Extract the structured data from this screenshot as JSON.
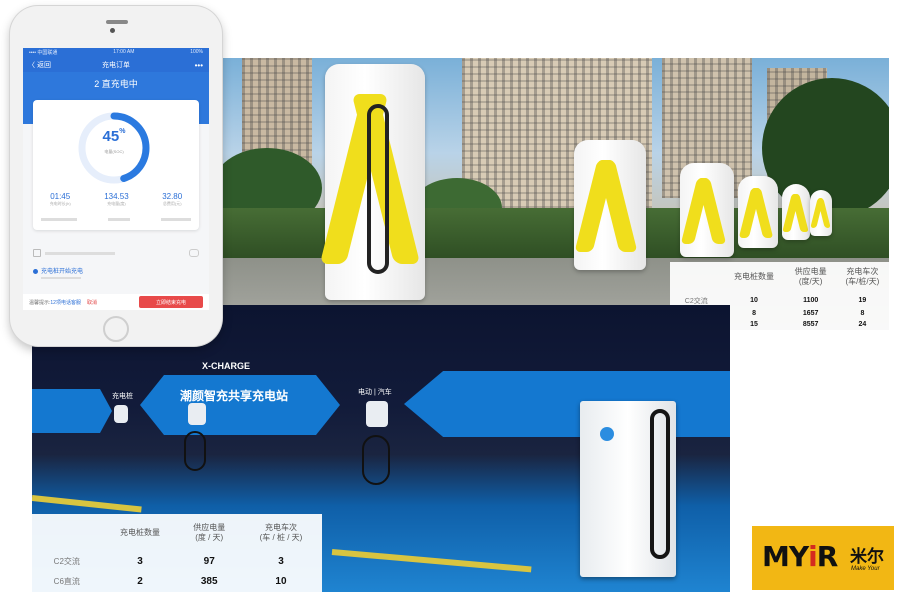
{
  "phone": {
    "status_left": "•••• 中国联通",
    "status_time": "17:00 AM",
    "status_right": "100%",
    "nav_back": "〈 返回",
    "nav_title": "充电订单",
    "nav_more": "•••",
    "heading": "2 直充电中",
    "percent": "45",
    "percent_unit": "%",
    "percent_sub": "电量(SOC)",
    "progress": 0.45,
    "stats": [
      {
        "value": "01:45",
        "label": "充电时长(h)"
      },
      {
        "value": "134.53",
        "label": "充电量(度)"
      },
      {
        "value": "32.80",
        "label": "总费用(元)"
      }
    ],
    "option_label": "充电桩开始充电",
    "bottom_tip_prefix": "温馨提示:",
    "bottom_tip_link": "12项电话客服",
    "cancel_label": "取消",
    "stop_button": "立即结束充电"
  },
  "photo_top_table": {
    "headers": [
      "充电桩数量",
      "供应电量\n(度/天)",
      "充电车次\n(车/桩/天)"
    ],
    "rows": [
      {
        "label": "C2交流",
        "values": [
          "10",
          "1100",
          "19"
        ]
      },
      {
        "label": "",
        "values": [
          "8",
          "1657",
          "8"
        ]
      },
      {
        "label": "",
        "values": [
          "15",
          "8557",
          "24"
        ]
      }
    ]
  },
  "photo_bottom": {
    "brand": "X-CHARGE",
    "sign_main": "潮颜智充共享充电站",
    "sign_left": "充电桩",
    "sign_right": "电动 | 汽车"
  },
  "photo_bottom_table": {
    "headers": [
      "充电桩数量",
      "供应电量\n(度 / 天)",
      "充电车次\n(车 / 桩 / 天)"
    ],
    "rows": [
      {
        "label": "C2交流",
        "values": [
          "3",
          "97",
          "3"
        ]
      },
      {
        "label": "C6直流",
        "values": [
          "2",
          "385",
          "10"
        ]
      }
    ]
  },
  "logo": {
    "text_m": "MY",
    "text_i": "i",
    "text_r": "R",
    "cn": "米尔",
    "tag": "Make Your"
  },
  "colors": {
    "accent_blue": "#2b6fd6",
    "stop_red": "#e84a4a",
    "charger_yellow": "#f0de1c",
    "logo_orange": "#f2b714"
  }
}
